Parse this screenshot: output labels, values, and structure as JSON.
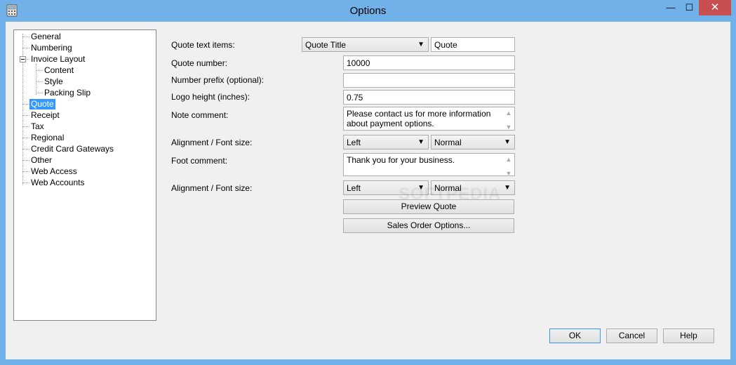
{
  "window": {
    "title": "Options",
    "close_glyph": "✕",
    "minimize_glyph": "—",
    "maximize_glyph": "☐",
    "accent_color": "#6fb1e8",
    "close_color": "#c74f4f"
  },
  "tree": {
    "items": [
      {
        "label": "General"
      },
      {
        "label": "Numbering"
      },
      {
        "label": "Invoice Layout"
      },
      {
        "label": "Content"
      },
      {
        "label": "Style"
      },
      {
        "label": "Packing Slip"
      },
      {
        "label": "Quote"
      },
      {
        "label": "Receipt"
      },
      {
        "label": "Tax"
      },
      {
        "label": "Regional"
      },
      {
        "label": "Credit Card Gateways"
      },
      {
        "label": "Other"
      },
      {
        "label": "Web Access"
      },
      {
        "label": "Web Accounts"
      }
    ],
    "selected": "Quote"
  },
  "form": {
    "quote_text_items_label": "Quote text items:",
    "quote_text_items_selected": "Quote Title",
    "quote_text_items_value": "Quote",
    "quote_number_label": "Quote number:",
    "quote_number_value": "10000",
    "number_prefix_label": "Number prefix (optional):",
    "number_prefix_value": "",
    "logo_height_label": "Logo height (inches):",
    "logo_height_value": "0.75",
    "note_comment_label": "Note comment:",
    "note_comment_value": "Please contact us for more information about payment options.",
    "alignment_font_label_1": "Alignment / Font size:",
    "alignment_1": "Left",
    "font_size_1": "Normal",
    "foot_comment_label": "Foot comment:",
    "foot_comment_value": "Thank you for your business.",
    "alignment_font_label_2": "Alignment / Font size:",
    "alignment_2": "Left",
    "font_size_2": "Normal",
    "preview_button": "Preview Quote",
    "sales_order_button": "Sales Order Options..."
  },
  "dialog_buttons": {
    "ok": "OK",
    "cancel": "Cancel",
    "help": "Help"
  },
  "watermark": "SOFTPEDIA"
}
